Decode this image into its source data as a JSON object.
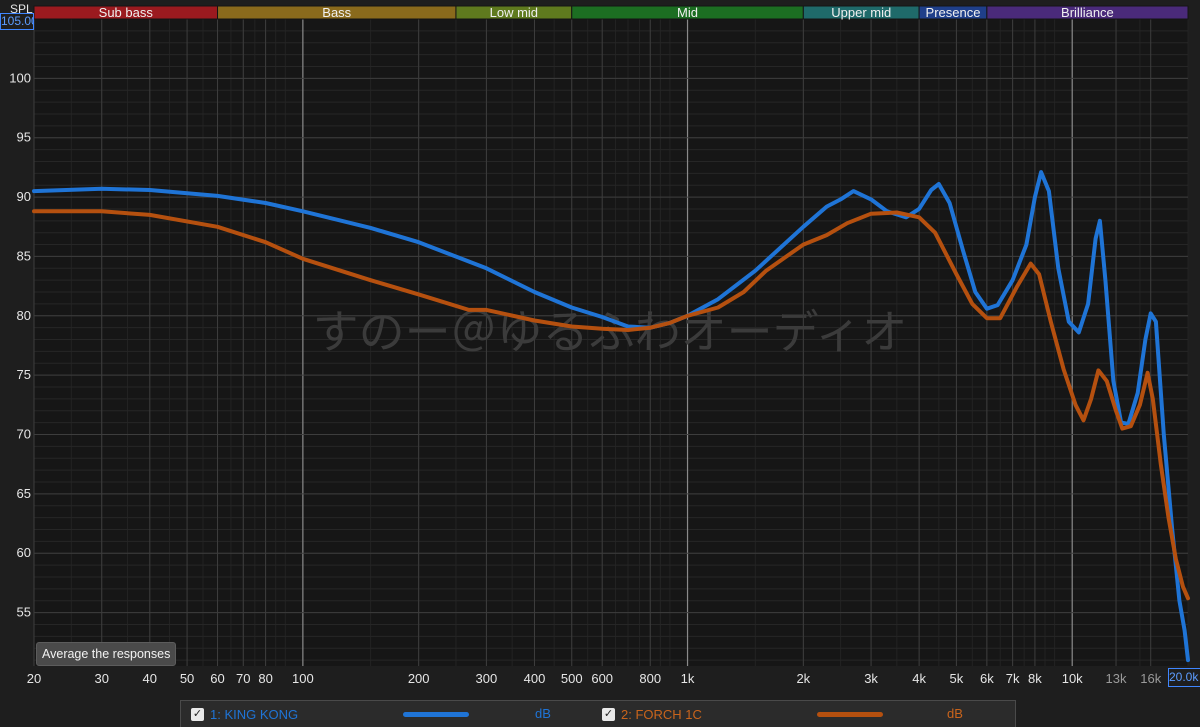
{
  "chart_data": {
    "type": "line",
    "ylabel": "SPL",
    "y_readout": "105.00",
    "x_readout": "20.0k",
    "xscale": "log",
    "xlim": [
      20,
      20000
    ],
    "ylim": [
      50.5,
      105
    ],
    "grid": true,
    "bands": [
      {
        "label": "Sub bass",
        "from": 20,
        "to": 60,
        "color": "#9b1a1f"
      },
      {
        "label": "Bass",
        "from": 60,
        "to": 250,
        "color": "#8a6a1c"
      },
      {
        "label": "Low mid",
        "from": 250,
        "to": 500,
        "color": "#5f7a1e"
      },
      {
        "label": "Mid",
        "from": 500,
        "to": 2000,
        "color": "#1c6e22"
      },
      {
        "label": "Upper mid",
        "from": 2000,
        "to": 4000,
        "color": "#1f6a6a"
      },
      {
        "label": "Presence",
        "from": 4000,
        "to": 6000,
        "color": "#1f3f8a"
      },
      {
        "label": "Brilliance",
        "from": 6000,
        "to": 20000,
        "color": "#4a2a7a"
      }
    ],
    "y_ticks": [
      "55",
      "60",
      "65",
      "70",
      "75",
      "80",
      "85",
      "90",
      "95",
      "100"
    ],
    "x_ticks": [
      {
        "label": "20",
        "value": 20
      },
      {
        "label": "30",
        "value": 30
      },
      {
        "label": "40",
        "value": 40
      },
      {
        "label": "50",
        "value": 50
      },
      {
        "label": "60",
        "value": 60
      },
      {
        "label": "70",
        "value": 70
      },
      {
        "label": "80",
        "value": 80
      },
      {
        "label": "100",
        "value": 100
      },
      {
        "label": "200",
        "value": 200
      },
      {
        "label": "300",
        "value": 300
      },
      {
        "label": "400",
        "value": 400
      },
      {
        "label": "500",
        "value": 500
      },
      {
        "label": "600",
        "value": 600
      },
      {
        "label": "800",
        "value": 800
      },
      {
        "label": "1k",
        "value": 1000
      },
      {
        "label": "2k",
        "value": 2000
      },
      {
        "label": "3k",
        "value": 3000
      },
      {
        "label": "4k",
        "value": 4000
      },
      {
        "label": "5k",
        "value": 5000
      },
      {
        "label": "6k",
        "value": 6000
      },
      {
        "label": "7k",
        "value": 7000
      },
      {
        "label": "8k",
        "value": 8000
      },
      {
        "label": "10k",
        "value": 10000
      },
      {
        "label": "13k",
        "value": 13000
      },
      {
        "label": "16k",
        "value": 16000
      }
    ],
    "series": [
      {
        "name": "1: KING KONG",
        "unit": "dB",
        "color": "#1f74d6",
        "points": [
          [
            20,
            90.5
          ],
          [
            30,
            90.7
          ],
          [
            40,
            90.6
          ],
          [
            60,
            90.1
          ],
          [
            80,
            89.5
          ],
          [
            100,
            88.8
          ],
          [
            150,
            87.4
          ],
          [
            200,
            86.2
          ],
          [
            300,
            84.0
          ],
          [
            400,
            82.0
          ],
          [
            500,
            80.7
          ],
          [
            600,
            79.9
          ],
          [
            700,
            79.1
          ],
          [
            800,
            79.0
          ],
          [
            900,
            79.4
          ],
          [
            1000,
            80.0
          ],
          [
            1200,
            81.4
          ],
          [
            1500,
            83.8
          ],
          [
            2000,
            87.5
          ],
          [
            2300,
            89.2
          ],
          [
            2500,
            89.8
          ],
          [
            2700,
            90.5
          ],
          [
            3000,
            89.8
          ],
          [
            3300,
            88.8
          ],
          [
            3700,
            88.3
          ],
          [
            4000,
            89.0
          ],
          [
            4300,
            90.6
          ],
          [
            4500,
            91.1
          ],
          [
            4800,
            89.5
          ],
          [
            5200,
            85.5
          ],
          [
            5600,
            82.0
          ],
          [
            6000,
            80.6
          ],
          [
            6400,
            80.9
          ],
          [
            7000,
            83.0
          ],
          [
            7600,
            86.0
          ],
          [
            8000,
            90.0
          ],
          [
            8300,
            92.1
          ],
          [
            8700,
            90.5
          ],
          [
            9200,
            84.0
          ],
          [
            9800,
            79.5
          ],
          [
            10400,
            78.6
          ],
          [
            11000,
            81.0
          ],
          [
            11500,
            86.5
          ],
          [
            11800,
            88.0
          ],
          [
            12200,
            83.0
          ],
          [
            12800,
            74.5
          ],
          [
            13400,
            71.0
          ],
          [
            14000,
            70.9
          ],
          [
            14800,
            73.5
          ],
          [
            15500,
            78.0
          ],
          [
            16000,
            80.2
          ],
          [
            16500,
            79.5
          ],
          [
            17300,
            70.0
          ],
          [
            18200,
            62.0
          ],
          [
            19000,
            56.0
          ],
          [
            19600,
            53.5
          ],
          [
            20000,
            51.0
          ]
        ]
      },
      {
        "name": "2: FORCH 1C",
        "unit": "dB",
        "color": "#b5500f",
        "points": [
          [
            20,
            88.8
          ],
          [
            30,
            88.8
          ],
          [
            40,
            88.5
          ],
          [
            60,
            87.5
          ],
          [
            80,
            86.2
          ],
          [
            100,
            84.8
          ],
          [
            150,
            83.0
          ],
          [
            200,
            81.8
          ],
          [
            270,
            80.5
          ],
          [
            300,
            80.5
          ],
          [
            400,
            79.6
          ],
          [
            500,
            79.1
          ],
          [
            600,
            78.9
          ],
          [
            700,
            78.8
          ],
          [
            800,
            79.0
          ],
          [
            900,
            79.4
          ],
          [
            1000,
            80.0
          ],
          [
            1200,
            80.7
          ],
          [
            1400,
            82.0
          ],
          [
            1600,
            83.8
          ],
          [
            2000,
            86.0
          ],
          [
            2300,
            86.8
          ],
          [
            2600,
            87.8
          ],
          [
            3000,
            88.6
          ],
          [
            3500,
            88.7
          ],
          [
            4000,
            88.3
          ],
          [
            4400,
            87.0
          ],
          [
            5000,
            83.5
          ],
          [
            5500,
            81.0
          ],
          [
            6000,
            79.8
          ],
          [
            6500,
            79.8
          ],
          [
            7200,
            82.5
          ],
          [
            7800,
            84.4
          ],
          [
            8200,
            83.5
          ],
          [
            8800,
            79.5
          ],
          [
            9500,
            75.5
          ],
          [
            10200,
            72.5
          ],
          [
            10700,
            71.2
          ],
          [
            11200,
            73.0
          ],
          [
            11700,
            75.4
          ],
          [
            12300,
            74.5
          ],
          [
            13000,
            72.0
          ],
          [
            13500,
            70.5
          ],
          [
            14200,
            70.7
          ],
          [
            15000,
            72.5
          ],
          [
            15700,
            75.2
          ],
          [
            16200,
            73.0
          ],
          [
            17000,
            67.5
          ],
          [
            17800,
            63.0
          ],
          [
            18600,
            59.5
          ],
          [
            19400,
            57.2
          ],
          [
            20000,
            56.2
          ]
        ]
      }
    ]
  },
  "watermark": "すのー＠ゆるふわオーディオ",
  "average_button": "Average the responses",
  "legend": [
    {
      "checked": "✓",
      "name": "1: KING KONG",
      "unit": "dB",
      "color": "#1f74d6"
    },
    {
      "checked": "✓",
      "name": "2: FORCH 1C",
      "unit": "dB",
      "color": "#b5500f"
    }
  ]
}
